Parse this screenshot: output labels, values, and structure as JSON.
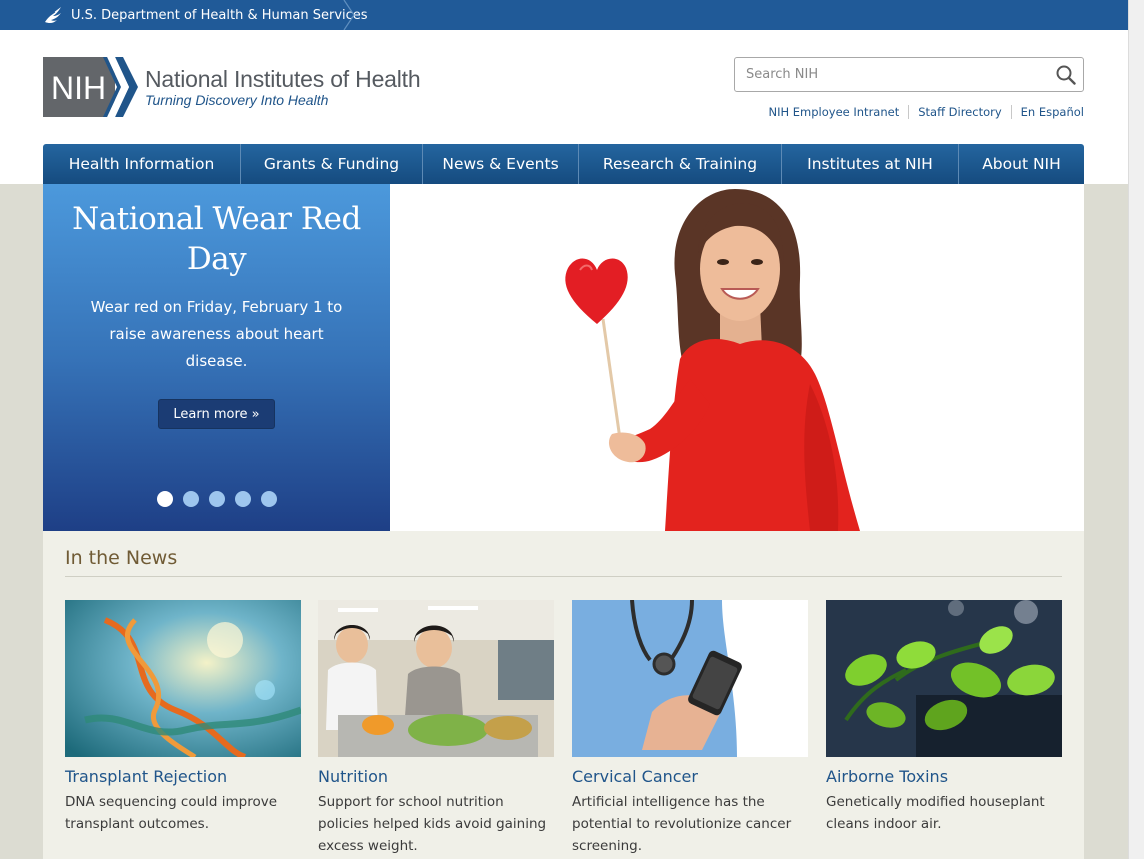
{
  "hhs_bar": {
    "label": "U.S. Department of Health & Human Services"
  },
  "logo": {
    "mark": "NIH",
    "title": "National Institutes of Health",
    "tagline": "Turning Discovery Into Health"
  },
  "search": {
    "placeholder": "Search NIH"
  },
  "utility_links": [
    {
      "label": "NIH Employee Intranet"
    },
    {
      "label": "Staff Directory"
    },
    {
      "label": "En Español"
    }
  ],
  "nav": [
    {
      "label": "Health Information"
    },
    {
      "label": "Grants & Funding"
    },
    {
      "label": "News & Events"
    },
    {
      "label": "Research & Training"
    },
    {
      "label": "Institutes at NIH"
    },
    {
      "label": "About NIH"
    }
  ],
  "hero": {
    "title": "National Wear Red Day",
    "text": "Wear red on Friday, February 1 to raise awareness about heart disease.",
    "button": "Learn more »",
    "slide_count": 5,
    "active_slide": 1
  },
  "news": {
    "heading": "In the News",
    "items": [
      {
        "title": "Transplant Rejection",
        "desc": "DNA sequencing could improve transplant outcomes."
      },
      {
        "title": "Nutrition",
        "desc": "Support for school nutrition policies helped kids avoid gaining excess weight."
      },
      {
        "title": "Cervical Cancer",
        "desc": "Artificial intelligence has the potential to revolutionize cancer screening."
      },
      {
        "title": "Airborne Toxins",
        "desc": "Genetically modified houseplant cleans indoor air."
      }
    ]
  },
  "colors": {
    "hhs_blue": "#205a98",
    "nav_blue": "#1b5490",
    "link_blue": "#20558a",
    "news_heading": "#705b35",
    "hero_red": "#e31e24"
  }
}
